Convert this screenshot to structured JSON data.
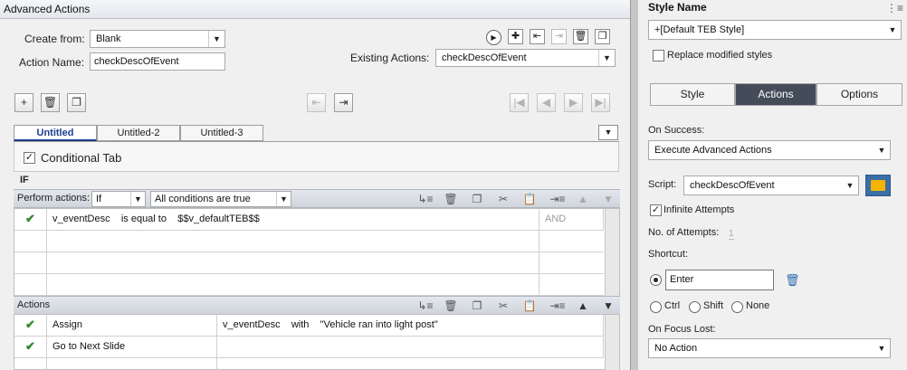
{
  "dialog": {
    "title": "Advanced Actions",
    "create_from_label": "Create from:",
    "create_from_value": "Blank",
    "action_name_label": "Action Name:",
    "action_name_value": "checkDescOfEvent",
    "existing_actions_label": "Existing Actions:",
    "existing_actions_value": "checkDescOfEvent",
    "tabs": [
      "Untitled",
      "Untitled-2",
      "Untitled-3"
    ],
    "conditional_tab_label": "Conditional Tab",
    "if_label": "IF",
    "perform_actions_label": "Perform actions:",
    "perform_actions_value": "If",
    "conditions_value": "All conditions are true",
    "conditions": [
      {
        "variable": "v_eventDesc",
        "operator": "is equal to",
        "value": "$$v_defaultTEB$$",
        "join": "AND"
      }
    ],
    "actions_label": "Actions",
    "actions": [
      {
        "action": "Assign",
        "target": "v_eventDesc",
        "with": "with",
        "value": "\"Vehicle ran into light post\""
      },
      {
        "action": "Go to Next Slide",
        "target": "",
        "with": "",
        "value": ""
      }
    ]
  },
  "panel": {
    "title": "Style Name",
    "style_value": "+[Default TEB Style]",
    "replace_label": "Replace modified styles",
    "tabs": [
      "Style",
      "Actions",
      "Options"
    ],
    "on_success_label": "On Success:",
    "on_success_value": "Execute Advanced Actions",
    "script_label": "Script:",
    "script_value": "checkDescOfEvent",
    "infinite_label": "Infinite Attempts",
    "attempts_label": "No. of Attempts:",
    "attempts_value": "1",
    "shortcut_label": "Shortcut:",
    "shortcut_value": "Enter",
    "mods": [
      "Ctrl",
      "Shift",
      "None"
    ],
    "focus_lost_label": "On Focus Lost:",
    "focus_lost_value": "No Action"
  },
  "colors": {
    "accent": "#1a3d8f",
    "active_tab": "#444b59",
    "check_green": "#2e8b2e"
  }
}
